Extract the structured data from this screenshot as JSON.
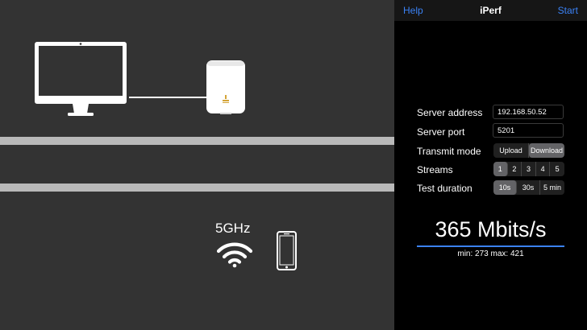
{
  "navbar": {
    "help": "Help",
    "title": "iPerf",
    "start": "Start"
  },
  "illustration": {
    "band": "5GHz"
  },
  "form": {
    "server_address": {
      "label": "Server address",
      "value": "192.168.50.52"
    },
    "server_port": {
      "label": "Server port",
      "value": "5201"
    },
    "transmit_mode": {
      "label": "Transmit mode",
      "options": [
        "Upload",
        "Download"
      ],
      "selected": "Download"
    },
    "streams": {
      "label": "Streams",
      "options": [
        "1",
        "2",
        "3",
        "4",
        "5"
      ],
      "selected": "1"
    },
    "test_duration": {
      "label": "Test duration",
      "options": [
        "10s",
        "30s",
        "5 min"
      ],
      "selected": "10s"
    }
  },
  "result": {
    "speed": "365 Mbits/s",
    "minmax": "min: 273 max: 421"
  },
  "colors": {
    "accent": "#3b82f6",
    "panel_bg": "#000000",
    "illus_bg": "#333333",
    "wall": "#b9b9b9"
  }
}
